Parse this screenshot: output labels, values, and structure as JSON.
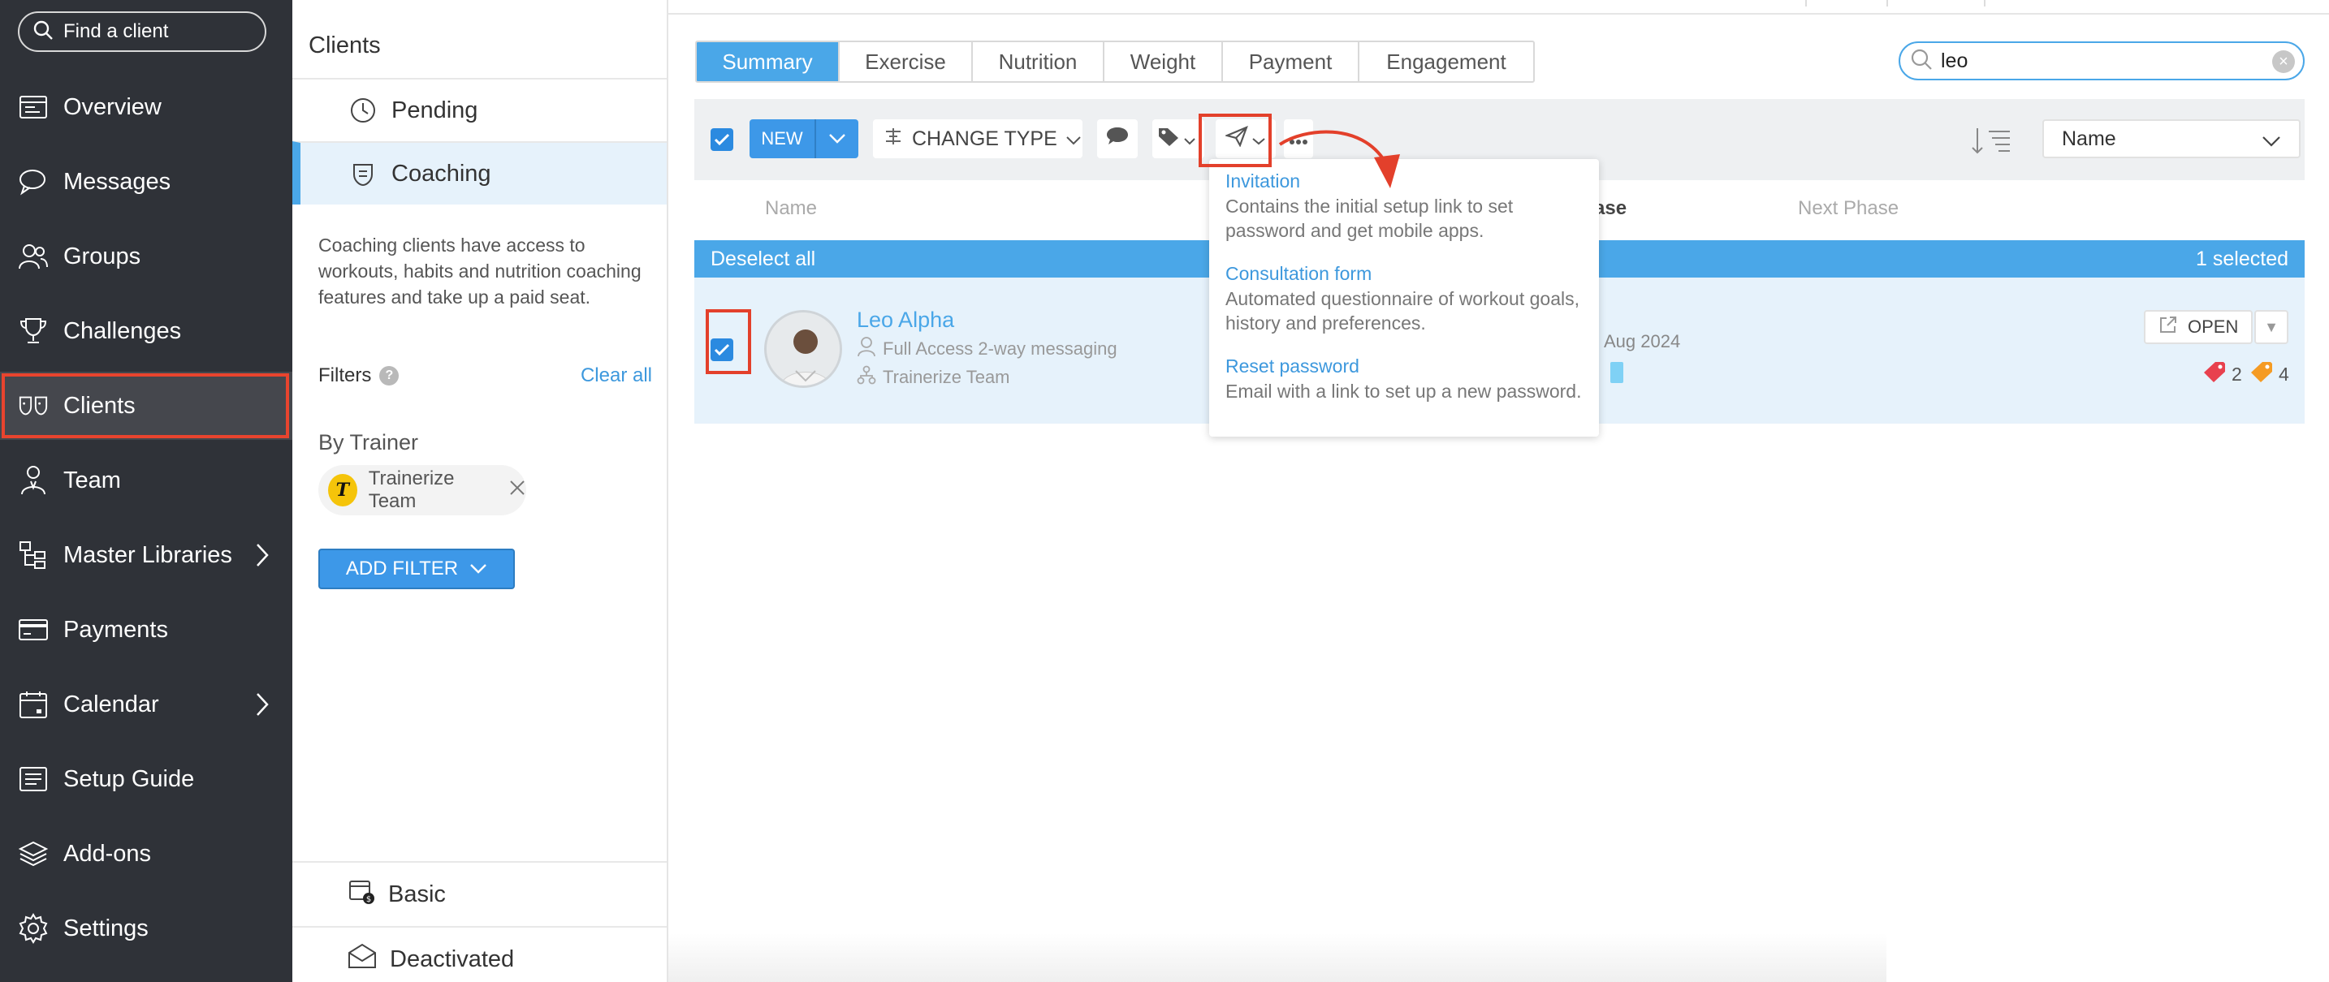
{
  "sidebar": {
    "search_label": "Find a client",
    "items": [
      {
        "label": "Overview",
        "icon": "overview-icon"
      },
      {
        "label": "Messages",
        "icon": "messages-icon"
      },
      {
        "label": "Groups",
        "icon": "groups-icon"
      },
      {
        "label": "Challenges",
        "icon": "trophy-icon"
      },
      {
        "label": "Clients",
        "icon": "clients-icon",
        "active": true
      },
      {
        "label": "Team",
        "icon": "team-icon"
      },
      {
        "label": "Master Libraries",
        "icon": "libraries-icon",
        "has_submenu": true
      },
      {
        "label": "Payments",
        "icon": "payments-icon"
      },
      {
        "label": "Calendar",
        "icon": "calendar-icon",
        "has_submenu": true
      },
      {
        "label": "Setup Guide",
        "icon": "setup-guide-icon"
      },
      {
        "label": "Add-ons",
        "icon": "addons-icon"
      },
      {
        "label": "Settings",
        "icon": "gear-icon"
      }
    ]
  },
  "categories": {
    "title": "Clients",
    "pending": "Pending",
    "coaching": "Coaching",
    "description": "Coaching clients have access to workouts, habits and nutrition coaching features and take up a paid seat.",
    "filters_label": "Filters",
    "help": "?",
    "clear_all": "Clear all",
    "by_trainer": "By Trainer",
    "trainer_chip": "Trainerize Team",
    "trainer_logo": "T",
    "add_filter": "ADD FILTER",
    "basic": "Basic",
    "deactivated": "Deactivated"
  },
  "tabs": [
    "Summary",
    "Exercise",
    "Nutrition",
    "Weight",
    "Payment",
    "Engagement"
  ],
  "active_tab": "Summary",
  "search": {
    "value": "leo"
  },
  "toolbar": {
    "new_label": "NEW",
    "change_type_label": "CHANGE TYPE",
    "sort_label": "Name"
  },
  "columns": {
    "name": "Name",
    "phase": "ase",
    "next_phase": "Next Phase"
  },
  "selection": {
    "deselect": "Deselect all",
    "count": "1 selected"
  },
  "client": {
    "name": "Leo Alpha",
    "access": "Full Access 2-way messaging",
    "team": "Trainerize Team",
    "date": "Aug 2024",
    "open": "OPEN",
    "red_tag_count": "2",
    "orange_tag_count": "4"
  },
  "dropdown": [
    {
      "title": "Invitation",
      "desc": "Contains the initial setup link to set password and get mobile apps."
    },
    {
      "title": "Consultation form",
      "desc": "Automated questionnaire of workout goals, history and preferences."
    },
    {
      "title": "Reset password",
      "desc": "Email with a link to set up a new password."
    }
  ],
  "colors": {
    "accent": "#4aa7e8",
    "sidebar": "#2f3238",
    "annotation": "#e3402b"
  }
}
